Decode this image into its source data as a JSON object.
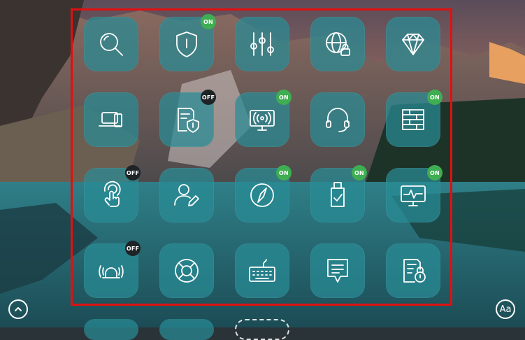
{
  "colors": {
    "tile": "#288c96",
    "badge_on": "#3fae52",
    "badge_off": "#1e2326",
    "highlight": "#e01010"
  },
  "tiles": [
    {
      "icon": "search-icon",
      "badge": ""
    },
    {
      "icon": "shield-icon",
      "badge": "ON"
    },
    {
      "icon": "sliders-icon",
      "badge": ""
    },
    {
      "icon": "globe-lock-icon",
      "badge": ""
    },
    {
      "icon": "diamond-icon",
      "badge": ""
    },
    {
      "icon": "devices-icon",
      "badge": ""
    },
    {
      "icon": "document-shield-icon",
      "badge": "OFF"
    },
    {
      "icon": "monitor-broadcast-icon",
      "badge": "ON"
    },
    {
      "icon": "headset-icon",
      "badge": ""
    },
    {
      "icon": "firewall-icon",
      "badge": "ON"
    },
    {
      "icon": "touch-icon",
      "badge": "OFF"
    },
    {
      "icon": "user-edit-icon",
      "badge": ""
    },
    {
      "icon": "compass-icon",
      "badge": "ON"
    },
    {
      "icon": "usb-check-icon",
      "badge": "ON"
    },
    {
      "icon": "monitor-pulse-icon",
      "badge": "ON"
    },
    {
      "icon": "alarm-icon",
      "badge": "OFF"
    },
    {
      "icon": "lifebuoy-icon",
      "badge": ""
    },
    {
      "icon": "keyboard-icon",
      "badge": ""
    },
    {
      "icon": "message-icon",
      "badge": ""
    },
    {
      "icon": "document-lock-icon",
      "badge": ""
    }
  ],
  "badges": {
    "t1": "ON",
    "t6": "OFF",
    "t7": "ON",
    "t9": "ON",
    "t10": "OFF",
    "t12": "ON",
    "t13": "ON",
    "t14": "ON",
    "t15": "OFF"
  },
  "corner": {
    "font_button_label": "Aa",
    "scroll_up_icon": "chevron-up-icon"
  }
}
